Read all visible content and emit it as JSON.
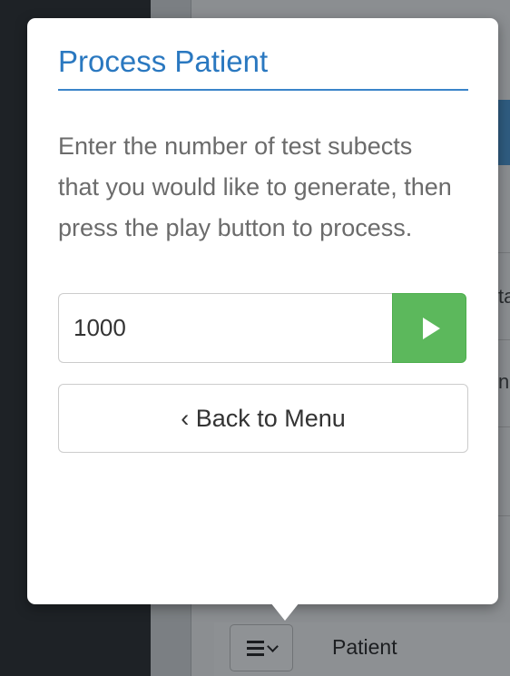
{
  "popover": {
    "title": "Process Patient",
    "description": "Enter the number of test subects that you would like to generate, then press the play button to process.",
    "count_value": "1000",
    "play_icon": "play-icon",
    "back_label": "‹ Back to Menu",
    "accent_color": "#2a78c0",
    "play_color": "#5cb85c"
  },
  "background": {
    "menu_toggle_icons": [
      "hamburger-icon",
      "chevron-down-icon"
    ],
    "bottom_label": "Patient",
    "fragment_1": "ta",
    "fragment_2": "n"
  }
}
